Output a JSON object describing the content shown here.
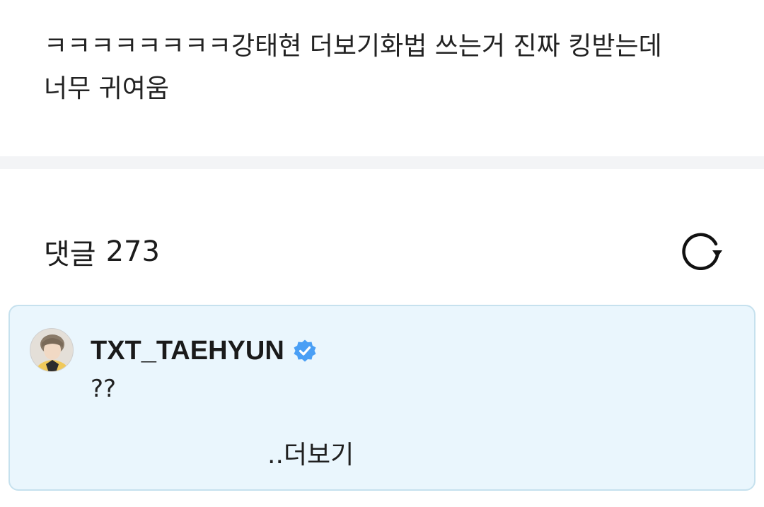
{
  "post": {
    "body_line1": "ㅋㅋㅋㅋㅋㅋㅋㅋ강태현 더보기화법 쓰는거 진짜 킹받는데",
    "body_line2": "너무 귀여움"
  },
  "comments_section": {
    "label": "댓글",
    "count": "273",
    "refresh_icon": "refresh-icon"
  },
  "comment": {
    "author": "TXT_TAEHYUN",
    "verified_icon": "verified-badge-icon",
    "text": "??",
    "more_label": "..더보기"
  },
  "colors": {
    "card_background": "#eaf6fd",
    "card_border": "#c6e1ee",
    "verified_blue": "#4a9ff5",
    "divider": "#f3f4f6"
  }
}
